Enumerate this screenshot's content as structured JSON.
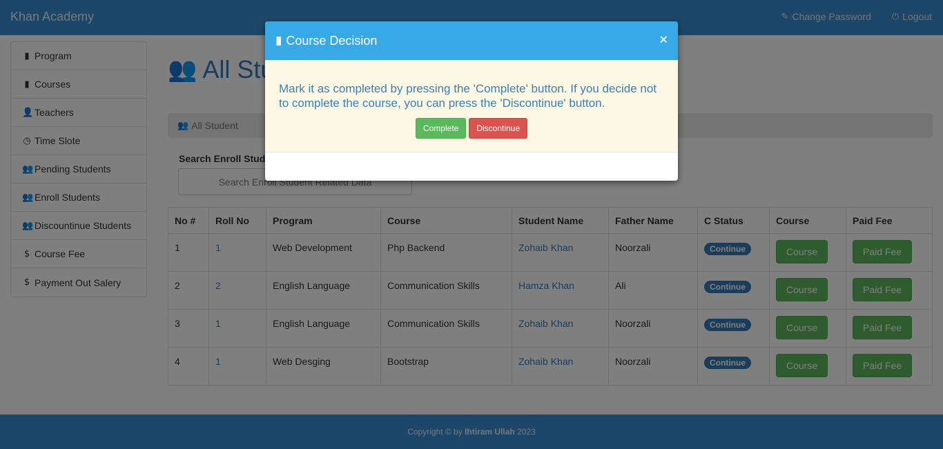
{
  "header": {
    "brand": "Khan Academy",
    "change_password": "Change Password",
    "logout": "Logout"
  },
  "sidebar": {
    "items": [
      {
        "label": "Program",
        "icon": "book-icon"
      },
      {
        "label": "Courses",
        "icon": "book-icon"
      },
      {
        "label": "Teachers",
        "icon": "user-icon"
      },
      {
        "label": "Time Slote",
        "icon": "clock-icon"
      },
      {
        "label": "Pending Students",
        "icon": "users-icon"
      },
      {
        "label": "Enroll Students",
        "icon": "users-icon"
      },
      {
        "label": "Discountinue Students",
        "icon": "users-icon"
      },
      {
        "label": "Course Fee",
        "icon": "dollar-icon"
      },
      {
        "label": "Payment Out Salery",
        "icon": "dollar-icon"
      }
    ]
  },
  "main": {
    "heading": "All Stu",
    "breadcrumb": "All Student",
    "search_label": "Search Enroll Stud",
    "search_placeholder": "Search Enroll Student Related Data"
  },
  "table": {
    "headers": [
      "No #",
      "Roll No",
      "Program",
      "Course",
      "Student Name",
      "Father Name",
      "C Status",
      "Course",
      "Paid Fee"
    ],
    "rows": [
      {
        "no": "1",
        "roll": "1",
        "program": "Web Development",
        "course": "Php Backend",
        "student": "Zohaib Khan",
        "father": "Noorzali",
        "status": "Continue",
        "course_btn": "Course",
        "fee_btn": "Paid Fee"
      },
      {
        "no": "2",
        "roll": "2",
        "program": "English Language",
        "course": "Communication Skills",
        "student": "Hamza Khan",
        "father": "Ali",
        "status": "Continue",
        "course_btn": "Course",
        "fee_btn": "Paid Fee"
      },
      {
        "no": "3",
        "roll": "1",
        "program": "English Language",
        "course": "Communication Skills",
        "student": "Zohaib Khan",
        "father": "Noorzali",
        "status": "Continue",
        "course_btn": "Course",
        "fee_btn": "Paid Fee"
      },
      {
        "no": "4",
        "roll": "1",
        "program": "Web Desging",
        "course": "Bootstrap",
        "student": "Zohaib Khan",
        "father": "Noorzali",
        "status": "Continue",
        "course_btn": "Course",
        "fee_btn": "Paid Fee"
      }
    ]
  },
  "footer": {
    "prefix": "Copyright © by",
    "author": "Ihtiram Ullah",
    "year": "2023"
  },
  "modal": {
    "title": "Course Decision",
    "close": "×",
    "message": "Mark it as completed by pressing the 'Complete' button. If you decide not to complete the course, you can press the 'Discontinue' button.",
    "complete_label": "Complete",
    "discontinue_label": "Discontinue"
  },
  "colors": {
    "header_bg": "#3b8fd1",
    "modal_header": "#37a9e6",
    "modal_body": "#fcf8e3",
    "complete": "#5cb85c",
    "discontinue": "#d9534f"
  }
}
